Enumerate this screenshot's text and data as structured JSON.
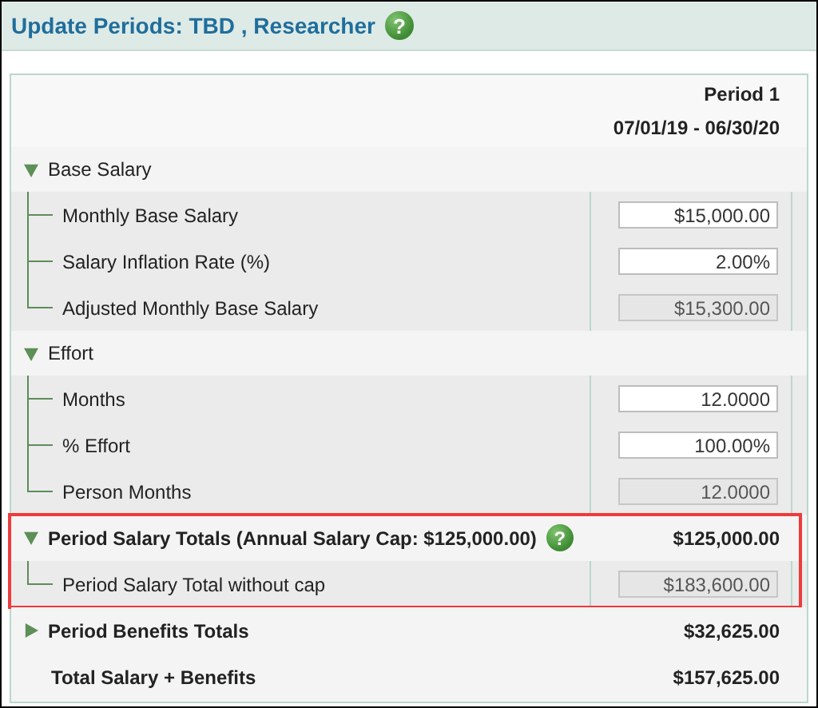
{
  "header": {
    "title": "Update Periods: TBD , Researcher",
    "help": "?"
  },
  "period": {
    "name": "Period 1",
    "dates": "07/01/19 - 06/30/20"
  },
  "sections": [
    {
      "kind": "category",
      "label": "Base Salary",
      "expanded": true,
      "rows": [
        {
          "label": "Monthly Base Salary",
          "value": "$15,000.00",
          "editable": true
        },
        {
          "label": "Salary Inflation Rate (%)",
          "value": "2.00%",
          "editable": true
        },
        {
          "label": "Adjusted Monthly Base Salary",
          "value": "$15,300.00",
          "editable": false
        }
      ]
    },
    {
      "kind": "category",
      "label": "Effort",
      "expanded": true,
      "rows": [
        {
          "label": "Months",
          "value": "12.0000",
          "editable": true
        },
        {
          "label": "% Effort",
          "value": "100.00%",
          "editable": true
        },
        {
          "label": "Person Months",
          "value": "12.0000",
          "editable": false
        }
      ]
    },
    {
      "kind": "summary",
      "label": "Period Salary Totals (Annual Salary Cap: $125,000.00)",
      "help": "?",
      "total": "$125,000.00",
      "expanded": true,
      "highlighted": true,
      "rows": [
        {
          "label": "Period Salary Total without cap",
          "value": "$183,600.00",
          "editable": false
        }
      ]
    },
    {
      "kind": "summary",
      "label": "Period Benefits Totals",
      "total": "$32,625.00",
      "expanded": false,
      "highlighted": false
    },
    {
      "kind": "grand",
      "label": "Total Salary + Benefits",
      "total": "$157,625.00"
    }
  ]
}
